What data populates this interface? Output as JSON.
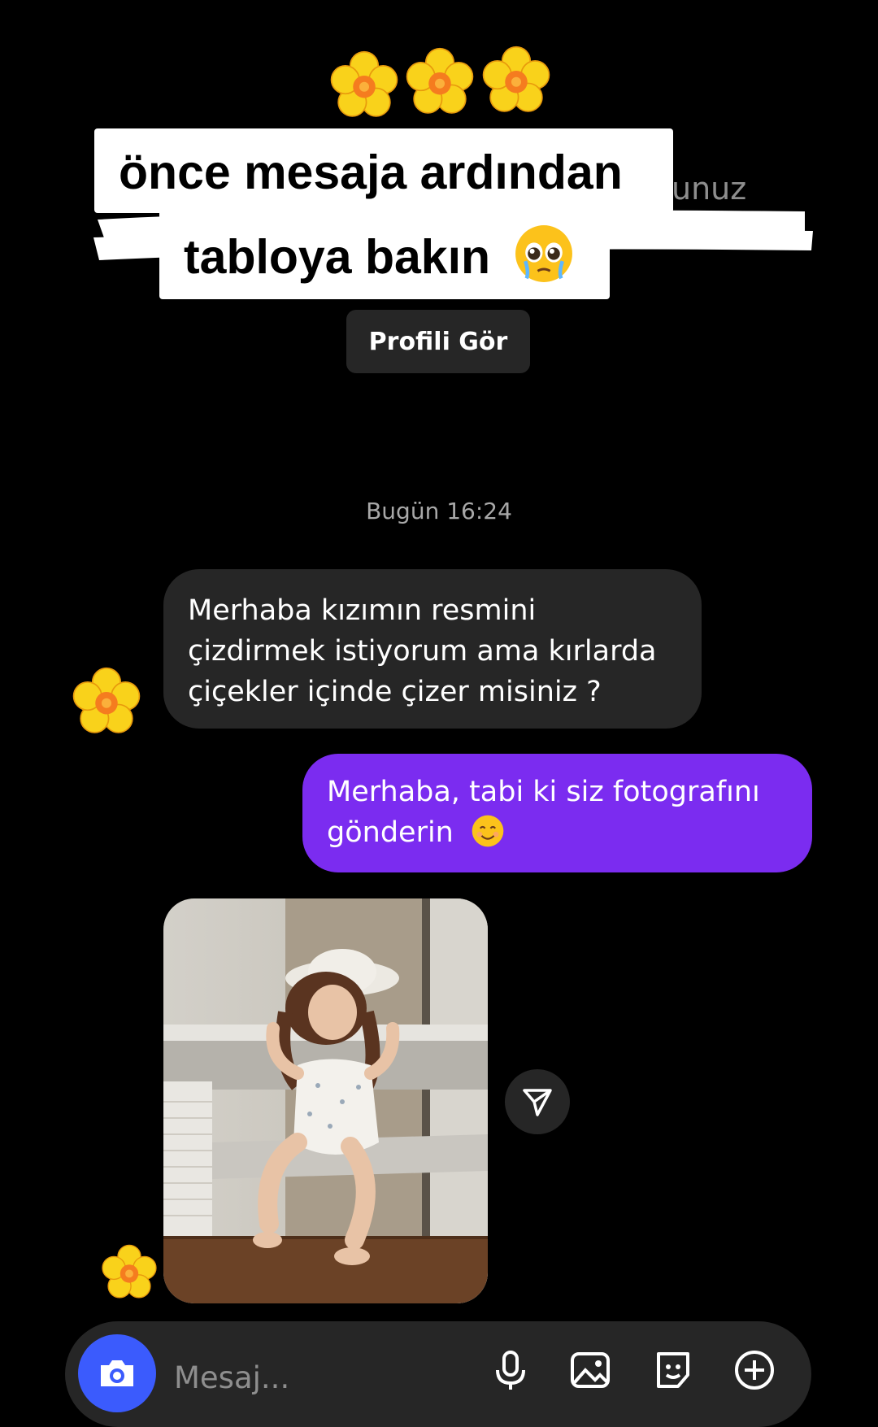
{
  "caption": {
    "line1": "önce mesaja ardından",
    "line2": "tabloya bakın"
  },
  "partial_header_text": "unuz",
  "profile_button_label": "Profili Gör",
  "timestamp": "Bugün 16:24",
  "messages": [
    {
      "direction": "incoming",
      "lines": [
        "Merhaba kızımın resmini",
        "çizdirmek istiyorum ama kırlarda",
        "çiçekler içinde çizer misiniz ?"
      ]
    },
    {
      "direction": "outgoing",
      "lines": [
        "Merhaba, tabi ki siz fotografını",
        "gönderin"
      ]
    }
  ],
  "composer": {
    "placeholder": "Mesaj..."
  },
  "colors": {
    "background": "#000000",
    "incoming_bubble": "#262626",
    "outgoing_bubble": "#7b2cf0",
    "camera_button": "#3b5bfd"
  },
  "icons": [
    "flower-emoji",
    "pleading-face-emoji",
    "smiling-face-emoji",
    "share-icon",
    "camera-icon",
    "microphone-icon",
    "gallery-icon",
    "sticker-icon",
    "plus-icon"
  ]
}
